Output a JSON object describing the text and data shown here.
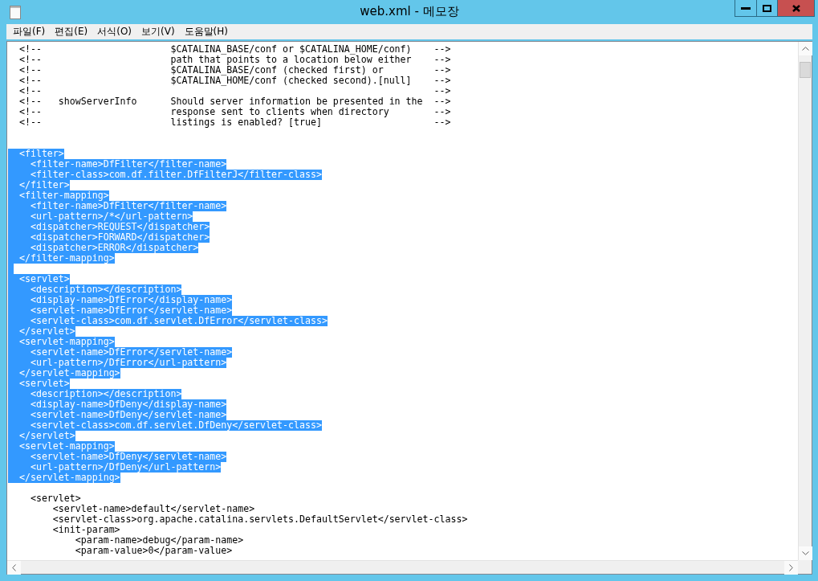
{
  "window": {
    "title": "web.xml - 메모장"
  },
  "menu": [
    "파일(F)",
    "편집(E)",
    "서식(O)",
    "보기(V)",
    "도움말(H)"
  ],
  "lines": [
    {
      "text": "  <!--                       $CATALINA_BASE/conf or $CATALINA_HOME/conf)    -->",
      "selected": false
    },
    {
      "text": "  <!--                       path that points to a location below either    -->",
      "selected": false
    },
    {
      "text": "  <!--                       $CATALINA_BASE/conf (checked first) or         -->",
      "selected": false
    },
    {
      "text": "  <!--                       $CATALINA_HOME/conf (checked second).[null]    -->",
      "selected": false
    },
    {
      "text": "  <!--                                                                      -->",
      "selected": false
    },
    {
      "text": "  <!--   showServerInfo      Should server information be presented in the  -->",
      "selected": false
    },
    {
      "text": "  <!--                       response sent to clients when directory        -->",
      "selected": false
    },
    {
      "text": "  <!--                       listings is enabled? [true]                    -->",
      "selected": false
    },
    {
      "selected": false
    },
    {
      "selected": false
    },
    {
      "text": "  <filter>",
      "selected": true
    },
    {
      "text": "    <filter-name>DfFilter</filter-name>",
      "selected": true
    },
    {
      "text": "    <filter-class>com.df.filter.DfFilterJ</filter-class>",
      "selected": true
    },
    {
      "text": "  </filter>",
      "selected": true
    },
    {
      "text": "  <filter-mapping>",
      "selected": true
    },
    {
      "text": "    <filter-name>DfFilter</filter-name>",
      "selected": true
    },
    {
      "text": "    <url-pattern>/*</url-pattern>",
      "selected": true
    },
    {
      "text": "    <dispatcher>REQUEST</dispatcher>",
      "selected": true
    },
    {
      "text": "    <dispatcher>FORWARD</dispatcher>",
      "selected": true
    },
    {
      "text": "    <dispatcher>ERROR</dispatcher>",
      "selected": true
    },
    {
      "text": "  </filter-mapping>",
      "selected": true
    },
    {
      "selected": true
    },
    {
      "text": "  <servlet>",
      "selected": true
    },
    {
      "text": "    <description></description>",
      "selected": true
    },
    {
      "text": "    <display-name>DfError</display-name>",
      "selected": true
    },
    {
      "text": "    <servlet-name>DfError</servlet-name>",
      "selected": true
    },
    {
      "text": "    <servlet-class>com.df.servlet.DfError</servlet-class>",
      "selected": true
    },
    {
      "text": "  </servlet>",
      "selected": true
    },
    {
      "text": "  <servlet-mapping>",
      "selected": true
    },
    {
      "text": "    <servlet-name>DfError</servlet-name>",
      "selected": true
    },
    {
      "text": "    <url-pattern>/DfError</url-pattern>",
      "selected": true
    },
    {
      "text": "  </servlet-mapping>",
      "selected": true
    },
    {
      "text": "  <servlet>",
      "selected": true
    },
    {
      "text": "    <description></description>",
      "selected": true
    },
    {
      "text": "    <display-name>DfDeny</display-name>",
      "selected": true
    },
    {
      "text": "    <servlet-name>DfDeny</servlet-name>",
      "selected": true
    },
    {
      "text": "    <servlet-class>com.df.servlet.DfDeny</servlet-class>",
      "selected": true
    },
    {
      "text": "  </servlet>",
      "selected": true
    },
    {
      "text": "  <servlet-mapping>",
      "selected": true
    },
    {
      "text": "    <servlet-name>DfDeny</servlet-name>",
      "selected": true
    },
    {
      "text": "    <url-pattern>/DfDeny</url-pattern>",
      "selected": true
    },
    {
      "text": "  </servlet-mapping>",
      "selected": true
    },
    {
      "selected": false
    },
    {
      "text": "    <servlet>",
      "selected": false
    },
    {
      "text": "        <servlet-name>default</servlet-name>",
      "selected": false
    },
    {
      "text": "        <servlet-class>org.apache.catalina.servlets.DefaultServlet</servlet-class>",
      "selected": false
    },
    {
      "text": "        <init-param>",
      "selected": false
    },
    {
      "text": "            <param-name>debug</param-name>",
      "selected": false
    },
    {
      "text": "            <param-value>0</param-value>",
      "selected": false
    }
  ]
}
